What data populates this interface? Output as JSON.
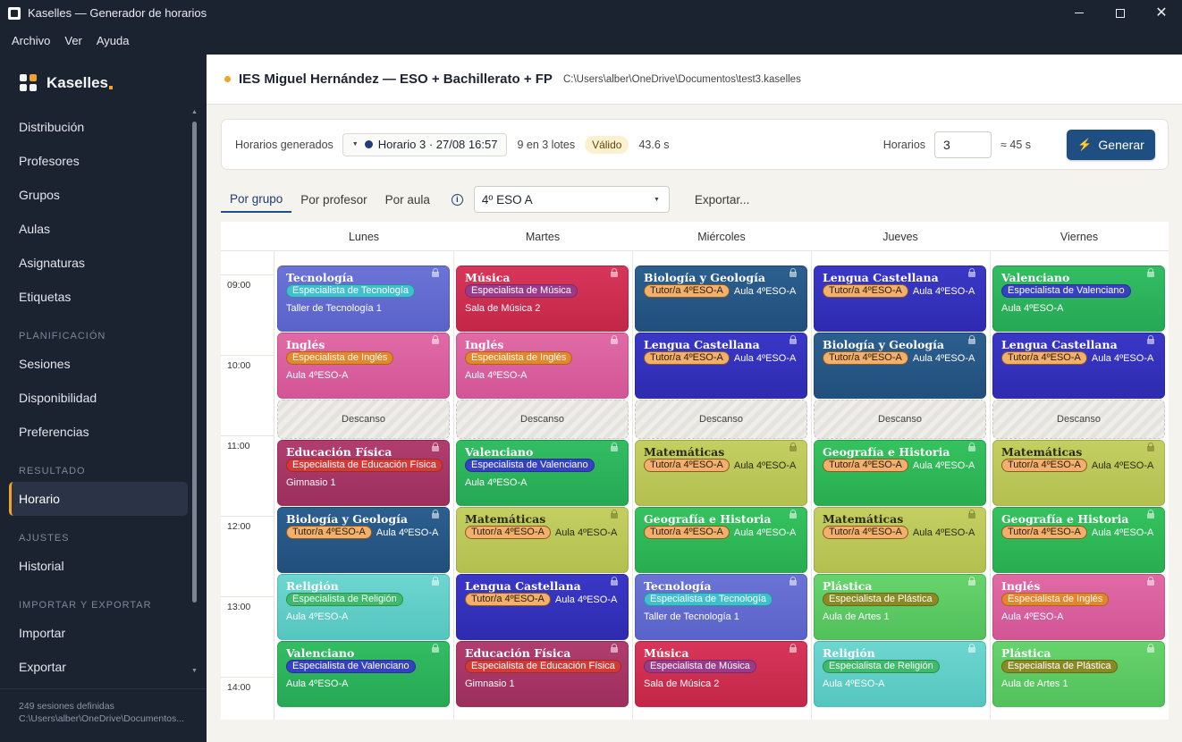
{
  "window": {
    "title": "Kaselles — Generador de horarios"
  },
  "menu": [
    "Archivo",
    "Ver",
    "Ayuda"
  ],
  "brand": {
    "name": "Kaselles"
  },
  "sidebar": {
    "items_top": [
      "Distribución",
      "Profesores",
      "Grupos",
      "Aulas",
      "Asignaturas",
      "Etiquetas"
    ],
    "section_planning": "PLANIFICACIÓN",
    "items_planning": [
      "Sesiones",
      "Disponibilidad",
      "Preferencias"
    ],
    "section_result": "RESULTADO",
    "items_result": [
      "Horario"
    ],
    "section_settings": "AJUSTES",
    "items_settings": [
      "Historial"
    ],
    "section_io": "IMPORTAR Y EXPORTAR",
    "items_io": [
      "Importar",
      "Exportar"
    ],
    "footer_sessions": "249 sesiones definidas",
    "footer_path": "C:\\Users\\alber\\OneDrive\\Documentos..."
  },
  "header": {
    "title": "IES Miguel Hernández — ESO + Bachillerato + FP",
    "path": "C:\\Users\\alber\\OneDrive\\Documentos\\test3.kaselles"
  },
  "generation": {
    "label": "Horarios generados",
    "selected": "Horario 3 · 27/08 16:57",
    "lots": "9 en 3 lotes",
    "status": "Válido",
    "time": "43.6 s",
    "count_label": "Horarios",
    "count_value": "3",
    "estimate": "≈ 45 s",
    "generate_label": "Generar"
  },
  "view": {
    "tabs": [
      "Por grupo",
      "Por profesor",
      "Por aula"
    ],
    "active_tab": 0,
    "group": "4º ESO A",
    "export_label": "Exportar..."
  },
  "days": [
    "Lunes",
    "Martes",
    "Miércoles",
    "Jueves",
    "Viernes"
  ],
  "hours": [
    "09:00",
    "10:00",
    "11:00",
    "12:00",
    "13:00",
    "14:00"
  ],
  "break_label": "Descanso",
  "timetable": [
    [
      {
        "subject": "Tecnología",
        "chip": "Especialista de Tecnología",
        "chip_type": "tec",
        "room": "Taller de Tecnología 1",
        "color": "tec"
      },
      {
        "subject": "Inglés",
        "chip": "Especialista de Inglés",
        "chip_type": "ing",
        "room": "Aula 4ºESO-A",
        "color": "ing"
      },
      {
        "break": true
      },
      {
        "subject": "Educación Física",
        "chip": "Especialista de Educación Física",
        "chip_type": "ef",
        "room": "Gimnasio 1",
        "color": "ef"
      },
      {
        "subject": "Biología y Geología",
        "chip": "Tutor/a 4ºESO-A",
        "chip_type": "tutor",
        "room": "Aula 4ºESO-A",
        "color": "bio",
        "inline": true
      },
      {
        "subject": "Religión",
        "chip": "Especialista de Religión",
        "chip_type": "rel",
        "room": "Aula 4ºESO-A",
        "color": "rel"
      },
      {
        "subject": "Valenciano",
        "chip": "Especialista de Valenciano",
        "chip_type": "val",
        "room": "Aula 4ºESO-A",
        "color": "val"
      }
    ],
    [
      {
        "subject": "Música",
        "chip": "Especialista de Música",
        "chip_type": "mus",
        "room": "Sala de Música 2",
        "color": "mus"
      },
      {
        "subject": "Inglés",
        "chip": "Especialista de Inglés",
        "chip_type": "ing",
        "room": "Aula 4ºESO-A",
        "color": "ing"
      },
      {
        "break": true
      },
      {
        "subject": "Valenciano",
        "chip": "Especialista de Valenciano",
        "chip_type": "val",
        "room": "Aula 4ºESO-A",
        "color": "val"
      },
      {
        "subject": "Matemáticas",
        "chip": "Tutor/a 4ºESO-A",
        "chip_type": "tutor",
        "room": "Aula 4ºESO-A",
        "color": "mat",
        "inline": true
      },
      {
        "subject": "Lengua Castellana",
        "chip": "Tutor/a 4ºESO-A",
        "chip_type": "tutor",
        "room": "Aula 4ºESO-A",
        "color": "len",
        "inline": true
      },
      {
        "subject": "Educación Física",
        "chip": "Especialista de Educación Física",
        "chip_type": "ef",
        "room": "Gimnasio 1",
        "color": "ef"
      }
    ],
    [
      {
        "subject": "Biología y Geología",
        "chip": "Tutor/a 4ºESO-A",
        "chip_type": "tutor",
        "room": "Aula 4ºESO-A",
        "color": "bio",
        "inline": true
      },
      {
        "subject": "Lengua Castellana",
        "chip": "Tutor/a 4ºESO-A",
        "chip_type": "tutor",
        "room": "Aula 4ºESO-A",
        "color": "len",
        "inline": true
      },
      {
        "break": true
      },
      {
        "subject": "Matemáticas",
        "chip": "Tutor/a 4ºESO-A",
        "chip_type": "tutor",
        "room": "Aula 4ºESO-A",
        "color": "mat",
        "inline": true
      },
      {
        "subject": "Geografía e Historia",
        "chip": "Tutor/a 4ºESO-A",
        "chip_type": "tutor",
        "room": "Aula 4ºESO-A",
        "color": "geo",
        "inline": true
      },
      {
        "subject": "Tecnología",
        "chip": "Especialista de Tecnología",
        "chip_type": "tec",
        "room": "Taller de Tecnología 1",
        "color": "tec"
      },
      {
        "subject": "Música",
        "chip": "Especialista de Música",
        "chip_type": "mus",
        "room": "Sala de Música 2",
        "color": "mus"
      }
    ],
    [
      {
        "subject": "Lengua Castellana",
        "chip": "Tutor/a 4ºESO-A",
        "chip_type": "tutor",
        "room": "Aula 4ºESO-A",
        "color": "len",
        "inline": true
      },
      {
        "subject": "Biología y Geología",
        "chip": "Tutor/a 4ºESO-A",
        "chip_type": "tutor",
        "room": "Aula 4ºESO-A",
        "color": "bio",
        "inline": true
      },
      {
        "break": true
      },
      {
        "subject": "Geografía e Historia",
        "chip": "Tutor/a 4ºESO-A",
        "chip_type": "tutor",
        "room": "Aula 4ºESO-A",
        "color": "geo",
        "inline": true
      },
      {
        "subject": "Matemáticas",
        "chip": "Tutor/a 4ºESO-A",
        "chip_type": "tutor",
        "room": "Aula 4ºESO-A",
        "color": "mat",
        "inline": true
      },
      {
        "subject": "Plástica",
        "chip": "Especialista de Plástica",
        "chip_type": "pla",
        "room": "Aula de Artes 1",
        "color": "pla"
      },
      {
        "subject": "Religión",
        "chip": "Especialista de Religión",
        "chip_type": "rel",
        "room": "Aula 4ºESO-A",
        "color": "rel"
      }
    ],
    [
      {
        "subject": "Valenciano",
        "chip": "Especialista de Valenciano",
        "chip_type": "val",
        "room": "Aula 4ºESO-A",
        "color": "val"
      },
      {
        "subject": "Lengua Castellana",
        "chip": "Tutor/a 4ºESO-A",
        "chip_type": "tutor",
        "room": "Aula 4ºESO-A",
        "color": "len",
        "inline": true
      },
      {
        "break": true
      },
      {
        "subject": "Matemáticas",
        "chip": "Tutor/a 4ºESO-A",
        "chip_type": "tutor",
        "room": "Aula 4ºESO-A",
        "color": "mat",
        "inline": true
      },
      {
        "subject": "Geografía e Historia",
        "chip": "Tutor/a 4ºESO-A",
        "chip_type": "tutor",
        "room": "Aula 4ºESO-A",
        "color": "geo",
        "inline": true
      },
      {
        "subject": "Inglés",
        "chip": "Especialista de Inglés",
        "chip_type": "ing",
        "room": "Aula 4ºESO-A",
        "color": "ing"
      },
      {
        "subject": "Plástica",
        "chip": "Especialista de Plástica",
        "chip_type": "pla",
        "room": "Aula de Artes 1",
        "color": "pla"
      }
    ]
  ]
}
